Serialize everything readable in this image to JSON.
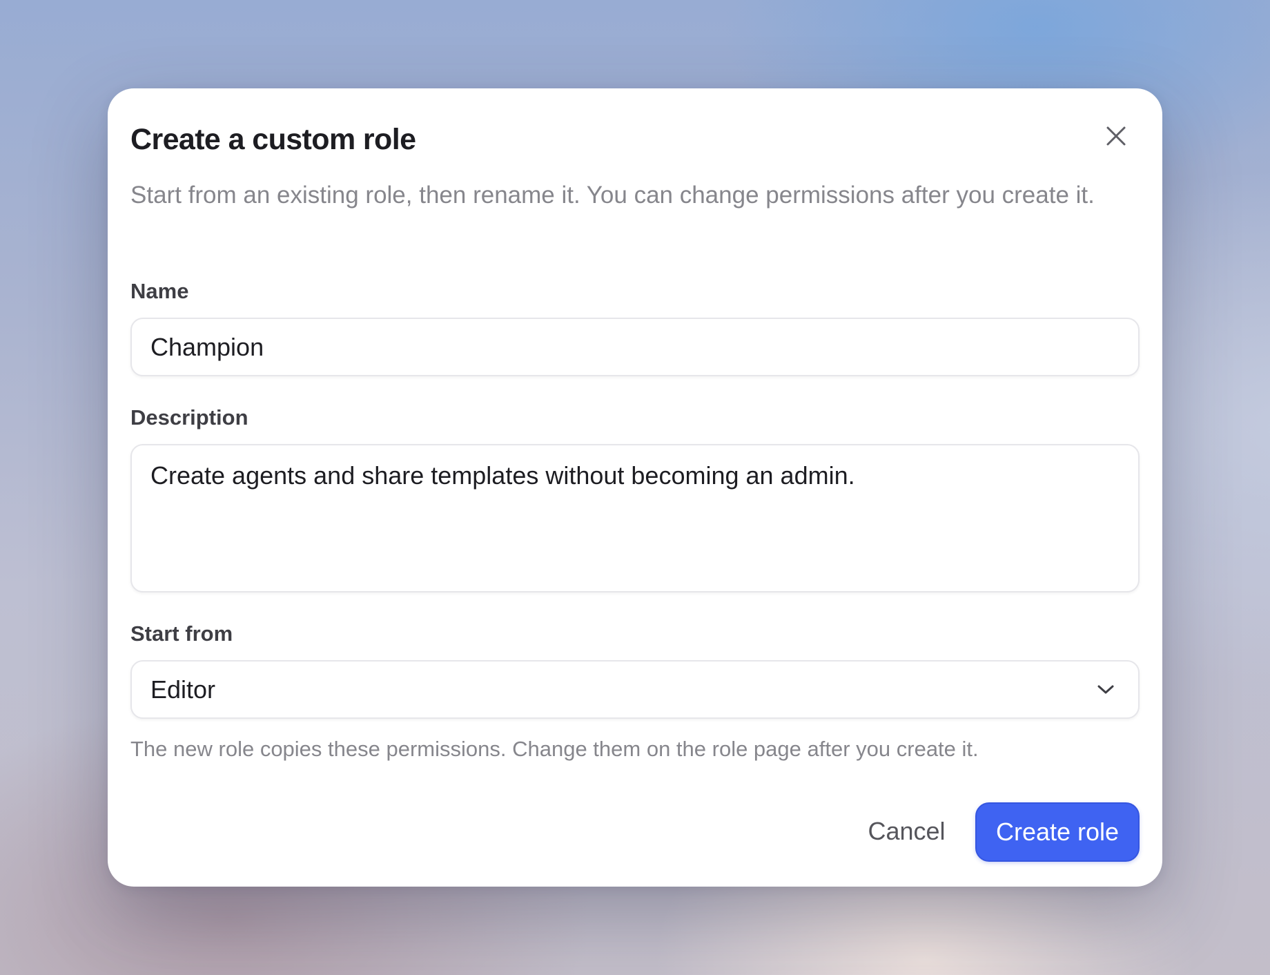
{
  "dialog": {
    "title": "Create a custom role",
    "subtitle": "Start from an existing role, then rename it. You can change permissions after you create it.",
    "close_icon": "close-icon"
  },
  "form": {
    "name": {
      "label": "Name",
      "value": "Champion"
    },
    "description": {
      "label": "Description",
      "value": "Create agents and share templates without becoming an admin."
    },
    "start_from": {
      "label": "Start from",
      "selected": "Editor",
      "icon": "chevron-down-icon",
      "hint": "The new role copies these permissions. Change them on the role page after you create it."
    }
  },
  "actions": {
    "cancel_label": "Cancel",
    "create_label": "Create role"
  },
  "colors": {
    "accent": "#3f63f2",
    "title_text": "#1d1d22",
    "muted_text": "#86868c"
  }
}
